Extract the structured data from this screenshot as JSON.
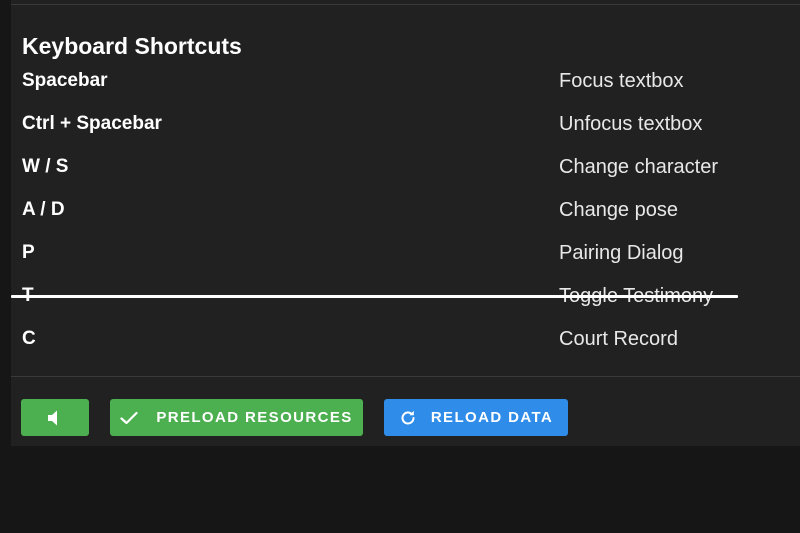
{
  "title": "Keyboard Shortcuts",
  "shortcuts": [
    {
      "key": "Spacebar",
      "action": "Focus textbox"
    },
    {
      "key": "Ctrl + Spacebar",
      "action": "Unfocus textbox"
    },
    {
      "key": "W / S",
      "action": "Change character"
    },
    {
      "key": "A / D",
      "action": "Change pose"
    },
    {
      "key": "P",
      "action": "Pairing Dialog"
    },
    {
      "key": "T",
      "action": "Toggle Testimony"
    },
    {
      "key": "C",
      "action": "Court Record"
    }
  ],
  "buttons": {
    "sound": {
      "icon": "volume-icon"
    },
    "preload": {
      "icon": "check-icon",
      "label": "PRELOAD RESOURCES"
    },
    "reload": {
      "icon": "refresh-icon",
      "label": "RELOAD DATA"
    }
  },
  "colors": {
    "panel_bg": "#212121",
    "page_bg": "#161616",
    "green": "#4caf50",
    "blue": "#2f8ce8"
  }
}
